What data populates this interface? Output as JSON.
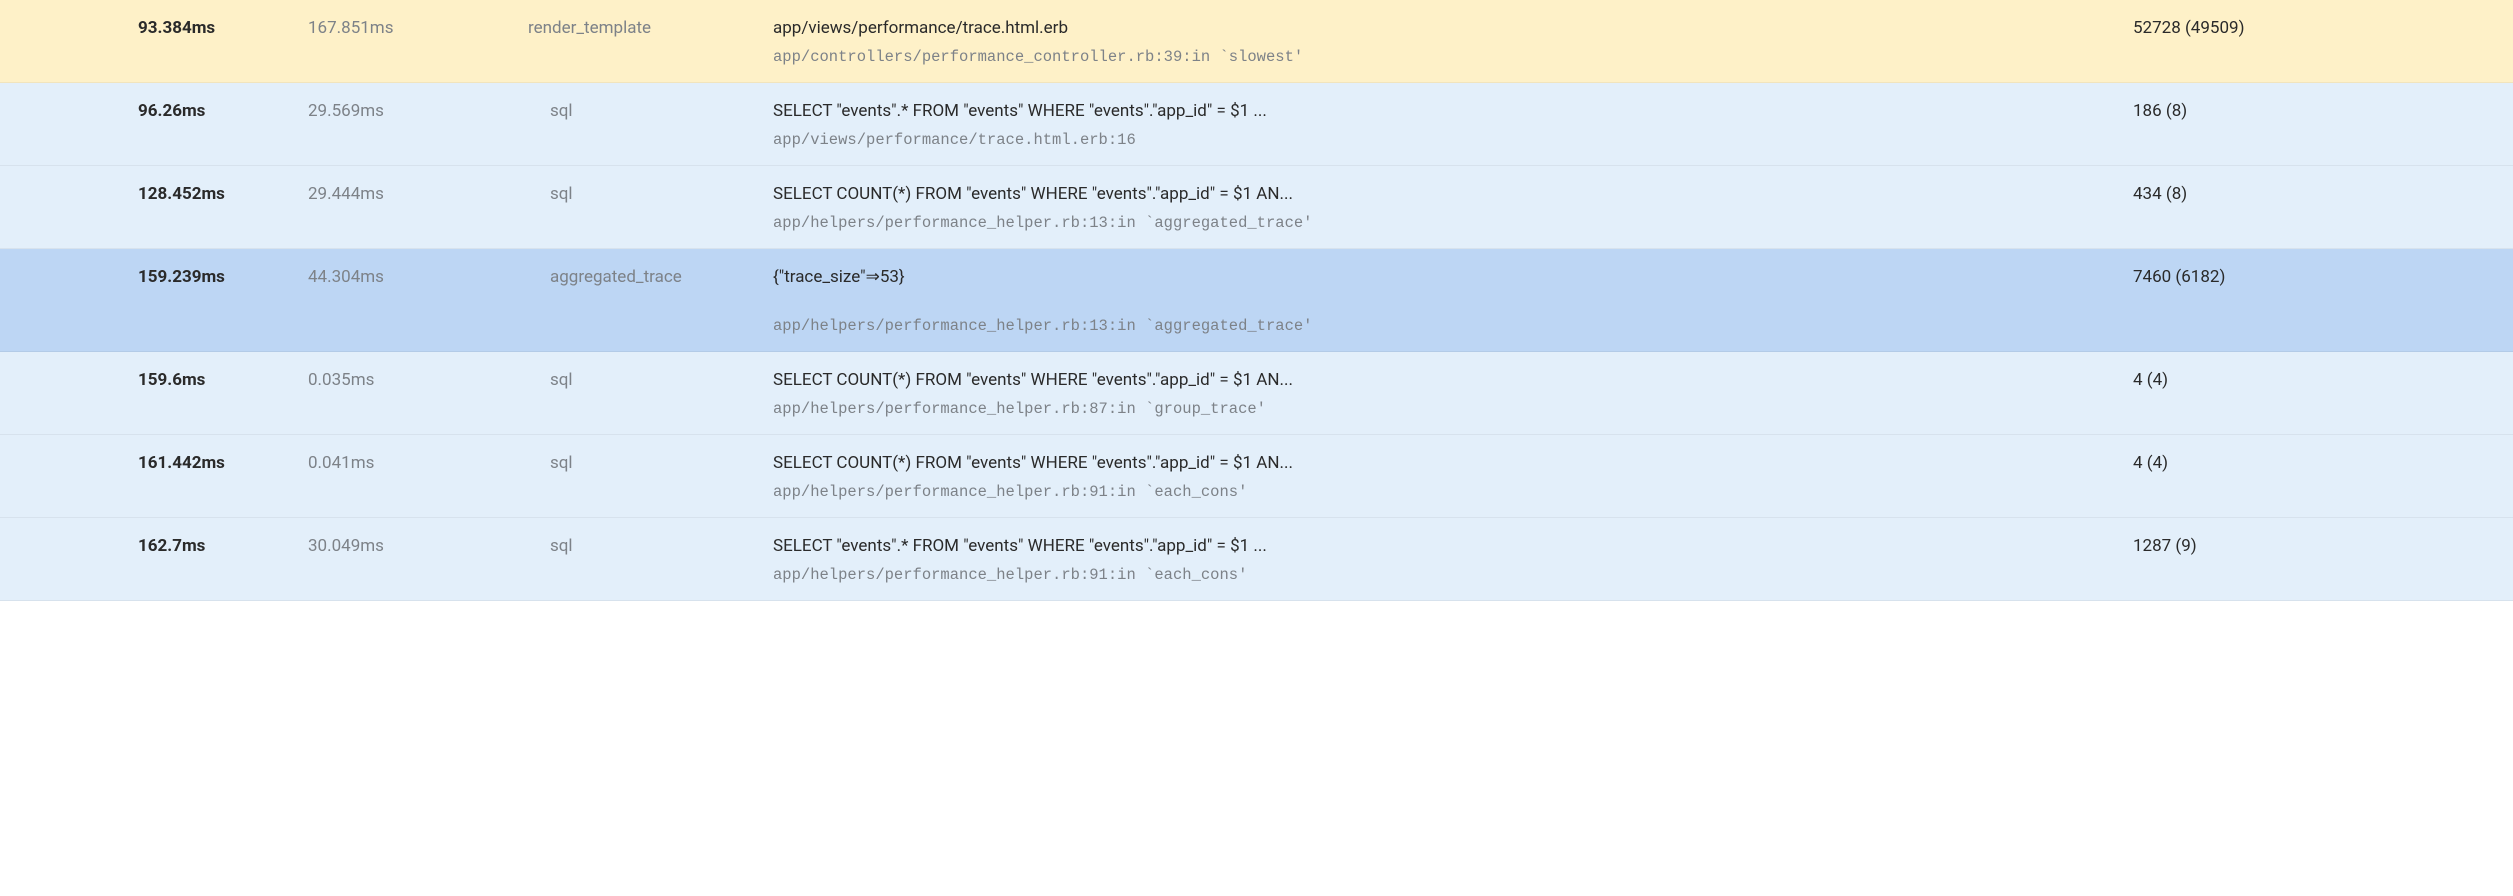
{
  "rows": [
    {
      "bg": "bg-yellow",
      "indent": false,
      "timestamp": "93.384ms",
      "duration": "167.851ms",
      "type": "render_template",
      "description": "app/views/performance/trace.html.erb",
      "source": "app/controllers/performance_controller.rb:39:in `slowest'",
      "count": "52728 (49509)",
      "doubleSpace": false
    },
    {
      "bg": "bg-blue-light",
      "indent": true,
      "timestamp": "96.26ms",
      "duration": "29.569ms",
      "type": "sql",
      "description": "SELECT \"events\".* FROM \"events\" WHERE \"events\".\"app_id\" = $1 ...",
      "source": "app/views/performance/trace.html.erb:16",
      "count": "186 (8)",
      "doubleSpace": false
    },
    {
      "bg": "bg-blue-light",
      "indent": true,
      "timestamp": "128.452ms",
      "duration": "29.444ms",
      "type": "sql",
      "description": "SELECT COUNT(*) FROM \"events\" WHERE \"events\".\"app_id\" = $1 AN...",
      "source": "app/helpers/performance_helper.rb:13:in `aggregated_trace'",
      "count": "434 (8)",
      "doubleSpace": false
    },
    {
      "bg": "bg-blue-mid",
      "indent": true,
      "timestamp": "159.239ms",
      "duration": "44.304ms",
      "type": "aggregated_trace",
      "description": "{\"trace_size\"⇒53}",
      "source": "app/helpers/performance_helper.rb:13:in `aggregated_trace'",
      "count": "7460 (6182)",
      "doubleSpace": true
    },
    {
      "bg": "bg-blue-light",
      "indent": true,
      "timestamp": "159.6ms",
      "duration": "0.035ms",
      "type": "sql",
      "description": "SELECT COUNT(*) FROM \"events\" WHERE \"events\".\"app_id\" = $1 AN...",
      "source": "app/helpers/performance_helper.rb:87:in `group_trace'",
      "count": "4 (4)",
      "doubleSpace": false
    },
    {
      "bg": "bg-blue-light",
      "indent": true,
      "timestamp": "161.442ms",
      "duration": "0.041ms",
      "type": "sql",
      "description": "SELECT COUNT(*) FROM \"events\" WHERE \"events\".\"app_id\" = $1 AN...",
      "source": "app/helpers/performance_helper.rb:91:in `each_cons'",
      "count": "4 (4)",
      "doubleSpace": false
    },
    {
      "bg": "bg-blue-light",
      "indent": true,
      "timestamp": "162.7ms",
      "duration": "30.049ms",
      "type": "sql",
      "description": "SELECT \"events\".* FROM \"events\" WHERE \"events\".\"app_id\" = $1 ...",
      "source": "app/helpers/performance_helper.rb:91:in `each_cons'",
      "count": "1287 (9)",
      "doubleSpace": false
    }
  ]
}
